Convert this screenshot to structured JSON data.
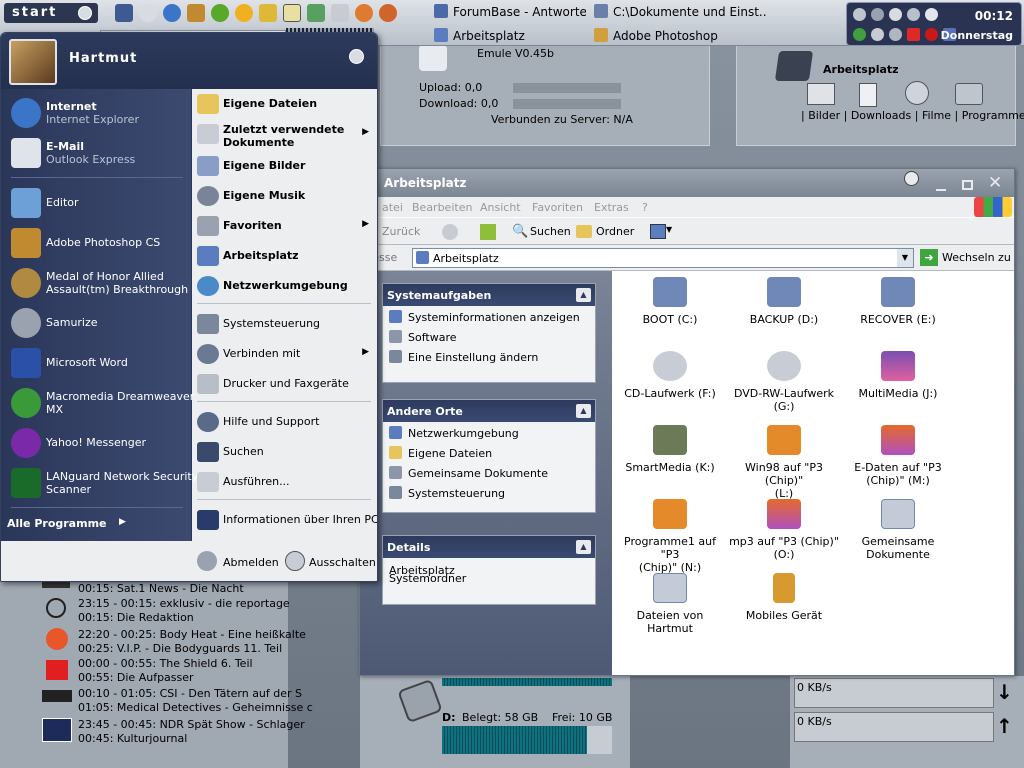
{
  "taskbar": {
    "start_label": "start",
    "tasks": [
      {
        "label": "ForumBase - Antworten..."
      },
      {
        "label": "C:\\Dokumente und Einst..."
      },
      {
        "label": "Arbeitsplatz"
      },
      {
        "label": "Adobe Photoshop"
      }
    ],
    "clock": "00:12",
    "day": "Donnerstag"
  },
  "network_widget": {
    "title": "Emule V0.45b",
    "upload": "Upload: 0,0",
    "download": "Download: 0,0",
    "server": "Verbunden zu Server: N/A"
  },
  "desktop_panel": {
    "title": "Arbeitsplatz",
    "links": "| Bilder | Downloads | Filme | Programme |"
  },
  "startmenu": {
    "user": "Hartmut",
    "pinned": [
      {
        "title": "Internet",
        "subtitle": "Internet Explorer"
      },
      {
        "title": "E-Mail",
        "subtitle": "Outlook Express"
      }
    ],
    "recent": [
      {
        "line1": "Editor"
      },
      {
        "line1": "Adobe Photoshop CS"
      },
      {
        "line1": "Medal of Honor Allied",
        "line2": "Assault(tm) Breakthrough"
      },
      {
        "line1": "Samurize"
      },
      {
        "line1": "Microsoft Word"
      },
      {
        "line1": "Macromedia Dreamweaver",
        "line2": "MX"
      },
      {
        "line1": "Yahoo! Messenger"
      },
      {
        "line1": "LANguard Network Security",
        "line2": "Scanner"
      }
    ],
    "all_programs": "Alle Programme",
    "right": [
      {
        "label": "Eigene Dateien"
      },
      {
        "label": "Zuletzt verwendete",
        "label2": "Dokumente"
      },
      {
        "label": "Eigene Bilder"
      },
      {
        "label": "Eigene Musik"
      },
      {
        "label": "Favoriten"
      },
      {
        "label": "Arbeitsplatz"
      },
      {
        "label": "Netzwerkumgebung"
      },
      {
        "label": "Systemsteuerung"
      },
      {
        "label": "Verbinden mit"
      },
      {
        "label": "Drucker und Faxgeräte"
      },
      {
        "label": "Hilfe und Support"
      },
      {
        "label": "Suchen"
      },
      {
        "label": "Ausführen..."
      },
      {
        "label": "Informationen über Ihren PC"
      }
    ],
    "logoff": "Abmelden",
    "shutdown": "Ausschalten"
  },
  "explorer": {
    "title": "Arbeitsplatz",
    "menu": [
      "atei",
      "Bearbeiten",
      "Ansicht",
      "Favoriten",
      "Extras",
      "?"
    ],
    "toolbar": {
      "back": "Zurück",
      "search": "Suchen",
      "folders": "Ordner"
    },
    "address_label": "resse",
    "address": "Arbeitsplatz",
    "go": "Wechseln zu",
    "tasks_title": "Systemaufgaben",
    "tasks": [
      "Systeminformationen anzeigen",
      "Software",
      "Eine Einstellung ändern"
    ],
    "places_title": "Andere Orte",
    "places": [
      "Netzwerkumgebung",
      "Eigene Dateien",
      "Gemeinsame Dokumente",
      "Systemsteuerung"
    ],
    "details_title": "Details",
    "details": [
      "Arbeitsplatz",
      "Systemordner"
    ],
    "items": [
      {
        "l1": "BOOT (C:)"
      },
      {
        "l1": "BACKUP (D:)"
      },
      {
        "l1": "RECOVER (E:)"
      },
      {
        "l1": "CD-Laufwerk (F:)"
      },
      {
        "l1": "DVD-RW-Laufwerk",
        "l2": "(G:)"
      },
      {
        "l1": "MultiMedia (J:)"
      },
      {
        "l1": "SmartMedia (K:)"
      },
      {
        "l1": "Win98 auf \"P3 (Chip)\"",
        "l2": "(L:)"
      },
      {
        "l1": "E-Daten auf \"P3",
        "l2": "(Chip)\" (M:)"
      },
      {
        "l1": "Programme1 auf \"P3",
        "l2": "(Chip)\" (N:)"
      },
      {
        "l1": "mp3 auf \"P3 (Chip)\"",
        "l2": "(O:)"
      },
      {
        "l1": "Gemeinsame",
        "l2": "Dokumente"
      },
      {
        "l1": "Dateien von Hartmut"
      },
      {
        "l1": "Mobiles Gerät"
      }
    ]
  },
  "tv_guide": [
    "00:15: Sat.1 News - Die Nacht",
    "23:15 - 00:15: exklusiv - die reportage",
    "00:15: Die Redaktion",
    "22:20 - 00:25: Body Heat - Eine heißkalte",
    "00:25: V.I.P. - Die Bodyguards 11. Teil",
    "00:00 - 00:55: The Shield 6. Teil",
    "00:55: Die Aufpasser",
    "00:10 - 01:05: CSI - Den Tätern auf der S",
    "01:05: Medical Detectives - Geheimnisse c",
    "23:45 - 00:45: NDR Spät Show - Schlager",
    "00:45: Kulturjournal"
  ],
  "disk": {
    "drive": "D:",
    "used": "Belegt: 58 GB",
    "free": "Frei: 10 GB",
    "used_fraction": 0.85
  },
  "net_speed": {
    "down": "0 KB/s",
    "up": "0 KB/s"
  }
}
